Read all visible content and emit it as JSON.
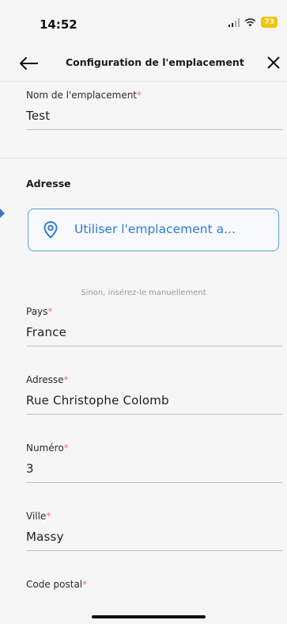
{
  "status": {
    "time": "14:52",
    "battery": "73"
  },
  "nav": {
    "title": "Configuration de l'emplacement"
  },
  "fields": {
    "name": {
      "label": "Nom de l'emplacement",
      "required": "*",
      "value": "Test"
    },
    "country": {
      "label": "Pays",
      "required": "*",
      "value": "France"
    },
    "address": {
      "label": "Adresse",
      "required": "*",
      "value": "Rue Christophe Colomb"
    },
    "number": {
      "label": "Numéro",
      "required": "*",
      "value": "3"
    },
    "city": {
      "label": "Ville",
      "required": "*",
      "value": "Massy"
    },
    "postal": {
      "label": "Code postal",
      "required": "*",
      "value": ""
    }
  },
  "section": {
    "address_title": "Adresse"
  },
  "location_button": {
    "label": "Utiliser l'emplacement a..."
  },
  "hint": "Sinon, insérez-le manuellement",
  "colors": {
    "accent": "#2f7ad6",
    "required": "#e07a7a",
    "battery": "#f3c400"
  },
  "icons": [
    "signal-icon",
    "wifi-icon",
    "back-arrow-icon",
    "close-icon",
    "location-pin-icon"
  ]
}
